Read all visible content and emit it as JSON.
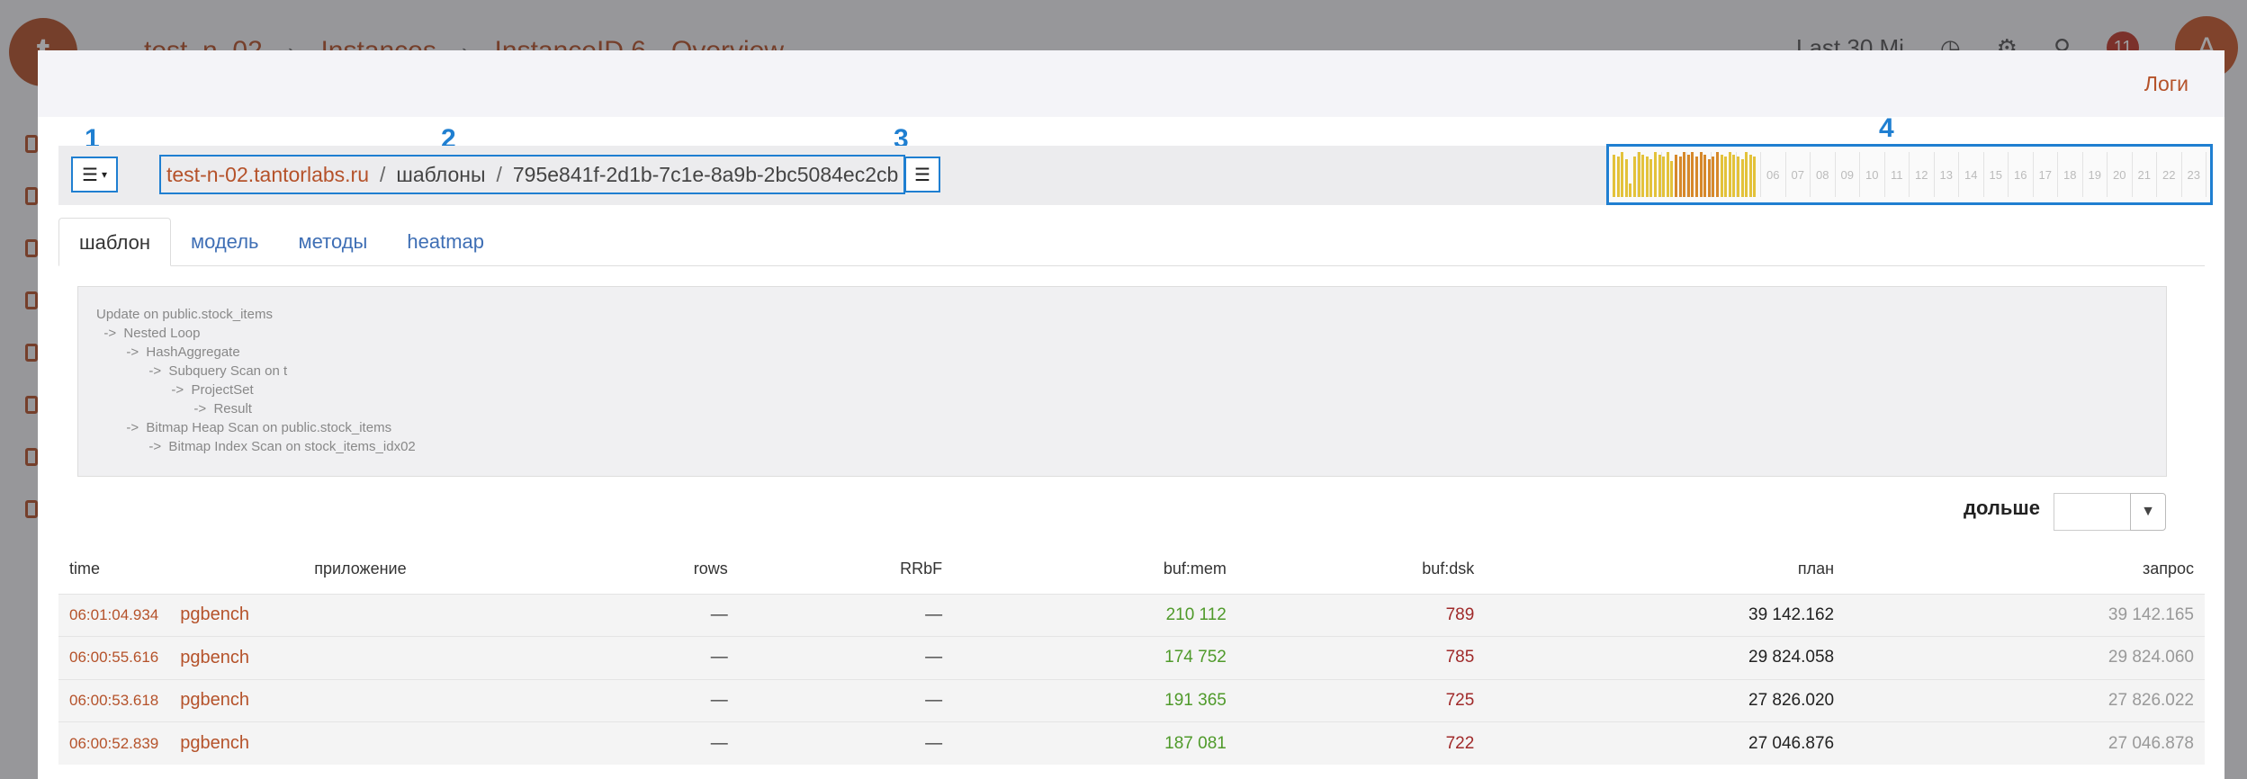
{
  "background": {
    "logo_glyph": "t",
    "breadcrumbs": [
      "test_n_02",
      "Instances",
      "InstanceID 6",
      "Overview"
    ],
    "time_text": "Last 30 Mi",
    "notification_count": "11",
    "avatar_letter": "A"
  },
  "modal": {
    "logs_link": "Логи",
    "annotations": [
      "1",
      "2",
      "3",
      "4"
    ],
    "path": {
      "host": "test-n-02.tantorlabs.ru",
      "section": "шаблоны",
      "id": "795e841f-2d1b-7c1e-8a9b-2bc5084ec2cb",
      "separator": "/"
    },
    "timeline": {
      "hours": [
        "",
        "",
        "",
        "",
        "",
        "",
        "06",
        "07",
        "08",
        "09",
        "10",
        "11",
        "12",
        "13",
        "14",
        "15",
        "16",
        "17",
        "18",
        "19",
        "20",
        "21",
        "22",
        "23"
      ],
      "bar_heights": [
        0.95,
        0.9,
        1.0,
        0.85,
        0.3,
        0.9,
        1.0,
        0.95,
        0.9,
        0.85,
        1.0,
        0.95,
        0.9,
        1.0,
        0.8,
        0.95,
        0.9,
        1.0,
        0.95,
        1.0,
        0.9,
        1.0,
        0.95,
        0.85,
        0.9,
        1.0,
        0.95,
        0.9,
        1.0,
        0.95,
        0.9,
        0.85,
        1.0,
        0.95,
        0.9
      ]
    },
    "tabs": [
      {
        "label": "шаблон",
        "active": true
      },
      {
        "label": "модель",
        "active": false
      },
      {
        "label": "методы",
        "active": false
      },
      {
        "label": "heatmap",
        "active": false
      }
    ],
    "plan_text": "Update on public.stock_items\n  ->  Nested Loop\n        ->  HashAggregate\n              ->  Subquery Scan on t\n                    ->  ProjectSet\n                          ->  Result\n        ->  Bitmap Heap Scan on public.stock_items\n              ->  Bitmap Index Scan on stock_items_idx02",
    "filter": {
      "label": "дольше",
      "value": ""
    },
    "table": {
      "headers": {
        "time": "time",
        "app": "приложение",
        "rows": "rows",
        "rrbf": "RRbF",
        "bufmem": "buf:mem",
        "bufdsk": "buf:dsk",
        "plan": "план",
        "req": "запрос"
      },
      "rows": [
        {
          "time": "06:01:04.934",
          "app": "pgbench",
          "rows": "—",
          "rrbf": "—",
          "bufmem": "210 112",
          "bufdsk": "789",
          "plan": "39 142.162",
          "req": "39 142.165"
        },
        {
          "time": "06:00:55.616",
          "app": "pgbench",
          "rows": "—",
          "rrbf": "—",
          "bufmem": "174 752",
          "bufdsk": "785",
          "plan": "29 824.058",
          "req": "29 824.060"
        },
        {
          "time": "06:00:53.618",
          "app": "pgbench",
          "rows": "—",
          "rrbf": "—",
          "bufmem": "191 365",
          "bufdsk": "725",
          "plan": "27 826.020",
          "req": "27 826.022"
        },
        {
          "time": "06:00:52.839",
          "app": "pgbench",
          "rows": "—",
          "rrbf": "—",
          "bufmem": "187 081",
          "bufdsk": "722",
          "plan": "27 046.876",
          "req": "27 046.878"
        }
      ]
    }
  }
}
